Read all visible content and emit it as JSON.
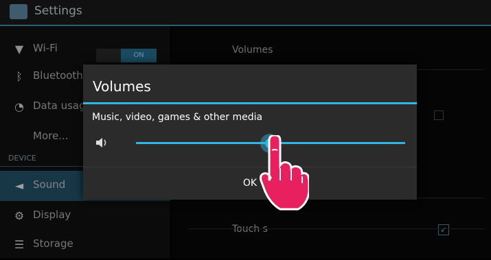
{
  "app": {
    "title": "Settings"
  },
  "sidebar": {
    "items": [
      {
        "icon": "wifi-icon",
        "glyph": "▼",
        "label": "Wi-Fi",
        "toggle": "ON"
      },
      {
        "icon": "bluetooth-icon",
        "glyph": "ᛒ",
        "label": "Bluetooth"
      },
      {
        "icon": "data-usage-icon",
        "glyph": "◔",
        "label": "Data usage"
      },
      {
        "icon": "",
        "glyph": "",
        "label": "More..."
      },
      {
        "icon": "sound-icon",
        "glyph": "◄",
        "label": "Sound"
      },
      {
        "icon": "display-icon",
        "glyph": "⚙",
        "label": "Display"
      },
      {
        "icon": "storage-icon",
        "glyph": "☰",
        "label": "Storage"
      }
    ],
    "section": "DEVICE"
  },
  "right": {
    "volumes_title": "Volumes",
    "touch_label": "Touch s"
  },
  "dialog": {
    "title": "Volumes",
    "label": "Music, video, games & other media",
    "slider_value": 0.5,
    "ok": "OK"
  },
  "colors": {
    "accent": "#33b5e5",
    "hand": "#e8205f"
  }
}
